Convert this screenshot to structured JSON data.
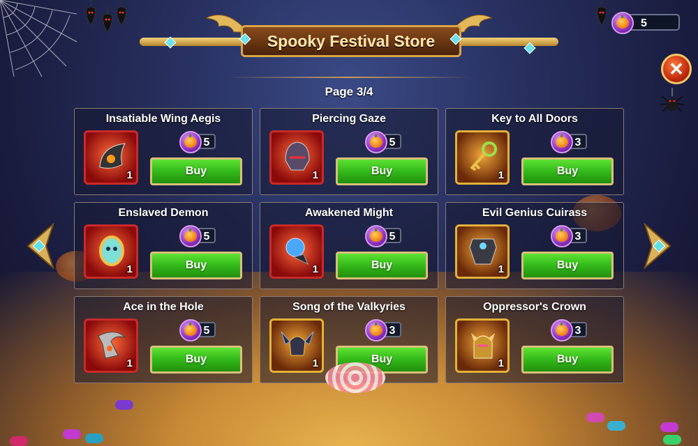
{
  "store": {
    "title": "Spooky Festival Store",
    "page_label": "Page 3/4"
  },
  "currency": {
    "icon": "pumpkin-coin-icon",
    "amount": "5"
  },
  "items": [
    {
      "name": "Insatiable Wing Aegis",
      "quantity": "1",
      "price": "5",
      "buy_label": "Buy",
      "frame": "red"
    },
    {
      "name": "Piercing Gaze",
      "quantity": "1",
      "price": "5",
      "buy_label": "Buy",
      "frame": "red"
    },
    {
      "name": "Key to All Doors",
      "quantity": "1",
      "price": "3",
      "buy_label": "Buy",
      "frame": "gold"
    },
    {
      "name": "Enslaved Demon",
      "quantity": "1",
      "price": "5",
      "buy_label": "Buy",
      "frame": "red"
    },
    {
      "name": "Awakened Might",
      "quantity": "1",
      "price": "5",
      "buy_label": "Buy",
      "frame": "red"
    },
    {
      "name": "Evil Genius Cuirass",
      "quantity": "1",
      "price": "3",
      "buy_label": "Buy",
      "frame": "gold"
    },
    {
      "name": "Ace in the Hole",
      "quantity": "1",
      "price": "5",
      "buy_label": "Buy",
      "frame": "red"
    },
    {
      "name": "Song of the Valkyries",
      "quantity": "1",
      "price": "3",
      "buy_label": "Buy",
      "frame": "gold"
    },
    {
      "name": "Oppressor's Crown",
      "quantity": "1",
      "price": "3",
      "buy_label": "Buy",
      "frame": "gold"
    }
  ],
  "colors": {
    "buy_green": "#33b91a",
    "red_frame": "#c82a2a",
    "gold_frame": "#e3b13a",
    "coin_purple": "#8c2fc0"
  }
}
